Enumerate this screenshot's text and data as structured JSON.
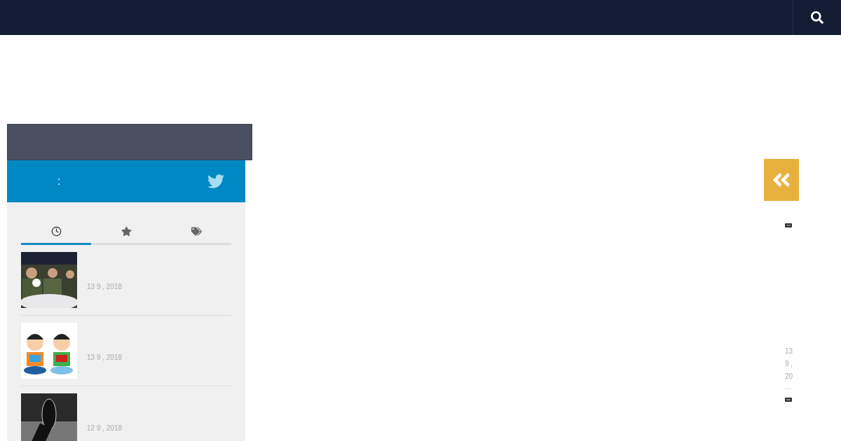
{
  "twitter_bar": {
    "label": ":"
  },
  "tabs": [
    {
      "kind": "recent",
      "selected": true
    },
    {
      "kind": "popular",
      "selected": false
    },
    {
      "kind": "tags",
      "selected": false
    }
  ],
  "posts": [
    {
      "kind": "picture",
      "date": "13 9 , 2018"
    },
    {
      "kind": "picture",
      "date": "13 9 , 2018"
    },
    {
      "kind": "picture",
      "date": "12 9 , 2018"
    }
  ],
  "right_column": {
    "date": "13 9 , 20"
  }
}
